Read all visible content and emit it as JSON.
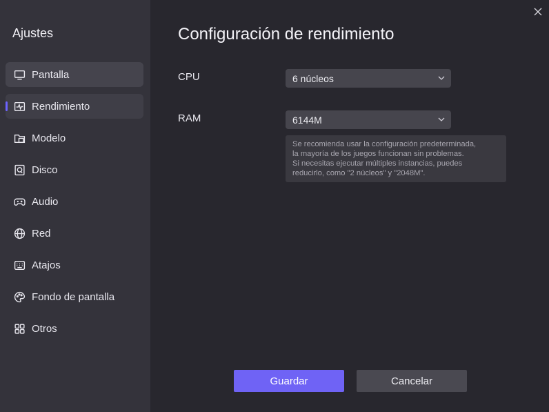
{
  "sidebar": {
    "title": "Ajustes",
    "items": [
      {
        "label": "Pantalla",
        "icon": "monitor-icon"
      },
      {
        "label": "Rendimiento",
        "icon": "performance-icon"
      },
      {
        "label": "Modelo",
        "icon": "folder-icon"
      },
      {
        "label": "Disco",
        "icon": "disk-icon"
      },
      {
        "label": "Audio",
        "icon": "gamepad-icon"
      },
      {
        "label": "Red",
        "icon": "globe-icon"
      },
      {
        "label": "Atajos",
        "icon": "keyboard-icon"
      },
      {
        "label": "Fondo de pantalla",
        "icon": "palette-icon"
      },
      {
        "label": "Otros",
        "icon": "grid-icon"
      }
    ]
  },
  "main": {
    "title": "Configuración de rendimiento",
    "cpu": {
      "label": "CPU",
      "value": "6 núcleos"
    },
    "ram": {
      "label": "RAM",
      "value": "6144M"
    },
    "hint": "Se recomienda usar la configuración predeterminada,\nla mayoría de los juegos funcionan sin problemas.\n Si necesitas ejecutar múltiples instancias, puedes\nreducirlo, como \"2 núcleos\" y \"2048M\"."
  },
  "buttons": {
    "save": "Guardar",
    "cancel": "Cancelar"
  },
  "colors": {
    "accent": "#6f63f5",
    "sidebar_bg": "#34333b",
    "main_bg": "#28272e"
  }
}
